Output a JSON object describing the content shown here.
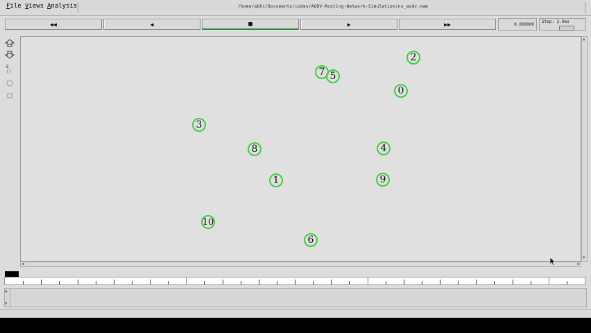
{
  "menu": {
    "file": "File",
    "views": "Views",
    "analysis": "Analysis"
  },
  "window_title": "/home/abhi/Documents/codes/AODV-Routing-Network-Simulation/ns_aodv.nam",
  "controls": {
    "rewind": "◀◀",
    "back": "◀",
    "stop": "■",
    "play": "▶",
    "fast_forward": "▶▶",
    "time": "0.000000",
    "step": "Step: 2.0ms"
  },
  "nodes": [
    {
      "id": "0",
      "label": "0"
    },
    {
      "id": "1",
      "label": "1"
    },
    {
      "id": "2",
      "label": "2"
    },
    {
      "id": "3",
      "label": "3"
    },
    {
      "id": "4",
      "label": "4"
    },
    {
      "id": "5",
      "label": "5"
    },
    {
      "id": "6",
      "label": "6"
    },
    {
      "id": "7",
      "label": "7"
    },
    {
      "id": "8",
      "label": "8"
    },
    {
      "id": "9",
      "label": "9"
    },
    {
      "id": "10",
      "label": "10"
    }
  ],
  "colors": {
    "node_ring": "#3ecf3e",
    "canvas": "#e0e0e0",
    "accent": "#2e8b3a"
  },
  "icons": {
    "tool1": "zoom-in-icon",
    "tool2": "zoom-out-icon",
    "tool3": "edit-icon"
  }
}
